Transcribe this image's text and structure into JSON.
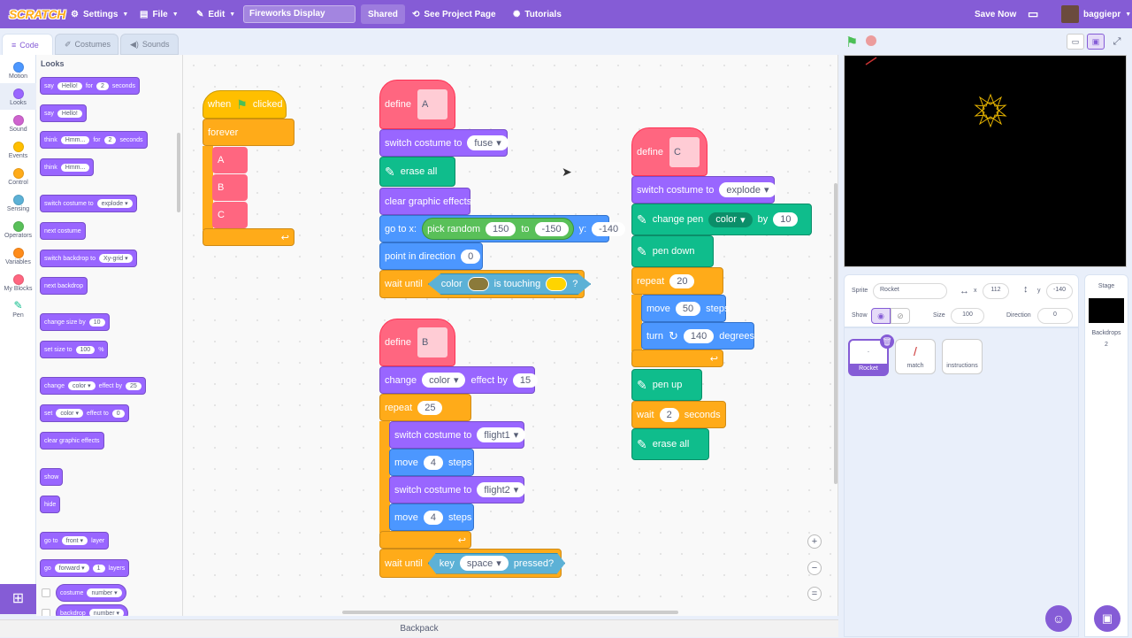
{
  "menu": {
    "logo": "SCRATCH",
    "settings": "Settings",
    "file": "File",
    "edit": "Edit",
    "project_title": "Fireworks Display",
    "shared": "Shared",
    "see_project": "See Project Page",
    "tutorials": "Tutorials",
    "save_now": "Save Now",
    "username": "baggiepr"
  },
  "tabs": {
    "code": "Code",
    "costumes": "Costumes",
    "sounds": "Sounds"
  },
  "categories": [
    {
      "label": "Motion",
      "color": "#4c97ff"
    },
    {
      "label": "Looks",
      "color": "#9966ff"
    },
    {
      "label": "Sound",
      "color": "#cf63cf"
    },
    {
      "label": "Events",
      "color": "#ffbf00"
    },
    {
      "label": "Control",
      "color": "#ffab19"
    },
    {
      "label": "Sensing",
      "color": "#5cb1d6"
    },
    {
      "label": "Operators",
      "color": "#59c059"
    },
    {
      "label": "Variables",
      "color": "#ff8c1a"
    },
    {
      "label": "My Blocks",
      "color": "#ff6680"
    },
    {
      "label": "Pen",
      "color": "#0fbd8c"
    }
  ],
  "palette": {
    "title": "Looks",
    "say_for": {
      "say": "say",
      "msg": "Hello!",
      "for": "for",
      "secs": "2",
      "seconds": "seconds"
    },
    "say": {
      "say": "say",
      "msg": "Hello!"
    },
    "think_for": {
      "think": "think",
      "msg": "Hmm...",
      "for": "for",
      "secs": "2",
      "seconds": "seconds"
    },
    "think": {
      "think": "think",
      "msg": "Hmm..."
    },
    "switch_costume": {
      "label": "switch costume to",
      "value": "explode"
    },
    "next_costume": "next costume",
    "switch_backdrop": {
      "label": "switch backdrop to",
      "value": "Xy-grid"
    },
    "next_backdrop": "next backdrop",
    "change_size": {
      "label": "change size by",
      "value": "10"
    },
    "set_size": {
      "label": "set size to",
      "value": "100",
      "unit": "%"
    },
    "change_effect": {
      "change": "change",
      "effect": "color",
      "by": "effect by",
      "value": "25"
    },
    "set_effect": {
      "set": "set",
      "effect": "color",
      "to": "effect to",
      "value": "0"
    },
    "clear_effects": "clear graphic effects",
    "show": "show",
    "hide": "hide",
    "go_to_layer": {
      "go": "go to",
      "value": "front",
      "layer": "layer"
    },
    "go_layers": {
      "go": "go",
      "dir": "forward",
      "n": "1",
      "layers": "layers"
    },
    "costume_reporter": {
      "label": "costume",
      "value": "number"
    },
    "backdrop_reporter": {
      "label": "backdrop",
      "value": "number"
    }
  },
  "scripts": {
    "s1": {
      "when": "when",
      "clicked": "clicked",
      "forever": "forever",
      "calls": [
        "A",
        "B",
        "C"
      ]
    },
    "sA": {
      "define": "define",
      "name": "A",
      "switch": "switch costume to",
      "costume": "fuse",
      "erase": "erase all",
      "clear": "clear graphic effects",
      "goto": "go to x:",
      "pick": "pick random",
      "from": "150",
      "to": "to",
      "tov": "-150",
      "y": "y:",
      "yv": "-140",
      "point": "point in direction",
      "dir": "0",
      "wait_until": "wait until",
      "color": "color",
      "touching": "is touching",
      "q": "?"
    },
    "sB": {
      "define": "define",
      "name": "B",
      "change": "change",
      "effect": "color",
      "by": "effect by",
      "val": "15",
      "repeat": "repeat",
      "times": "25",
      "switch1": "switch costume to",
      "c1": "flight1",
      "move1": "move",
      "m1": "4",
      "steps1": "steps",
      "switch2": "switch costume to",
      "c2": "flight2",
      "move2": "move",
      "m2": "4",
      "steps2": "steps",
      "wait_until": "wait until",
      "key": "key",
      "keyname": "space",
      "pressed": "pressed?"
    },
    "sC": {
      "define": "define",
      "name": "C",
      "switch": "switch costume to",
      "costume": "explode",
      "change_pen": "change pen",
      "pen_param": "color",
      "by": "by",
      "pen_val": "10",
      "pen_down": "pen down",
      "repeat": "repeat",
      "times": "20",
      "move": "move",
      "mv": "50",
      "steps": "steps",
      "turn": "turn",
      "deg": "140",
      "degrees": "degrees",
      "pen_up": "pen up",
      "wait": "wait",
      "secs": "2",
      "seconds": "seconds",
      "erase": "erase all"
    }
  },
  "sprite_info": {
    "sprite_label": "Sprite",
    "sprite_name": "Rocket",
    "x_label": "x",
    "x": "112",
    "y_label": "y",
    "y": "-140",
    "show_label": "Show",
    "size_label": "Size",
    "size": "100",
    "direction_label": "Direction",
    "direction": "0"
  },
  "sprites": [
    "Rocket",
    "match",
    "instructions"
  ],
  "stage_pane": {
    "title": "Stage",
    "backdrops_label": "Backdrops",
    "backdrops_count": "2"
  },
  "backpack": "Backpack"
}
